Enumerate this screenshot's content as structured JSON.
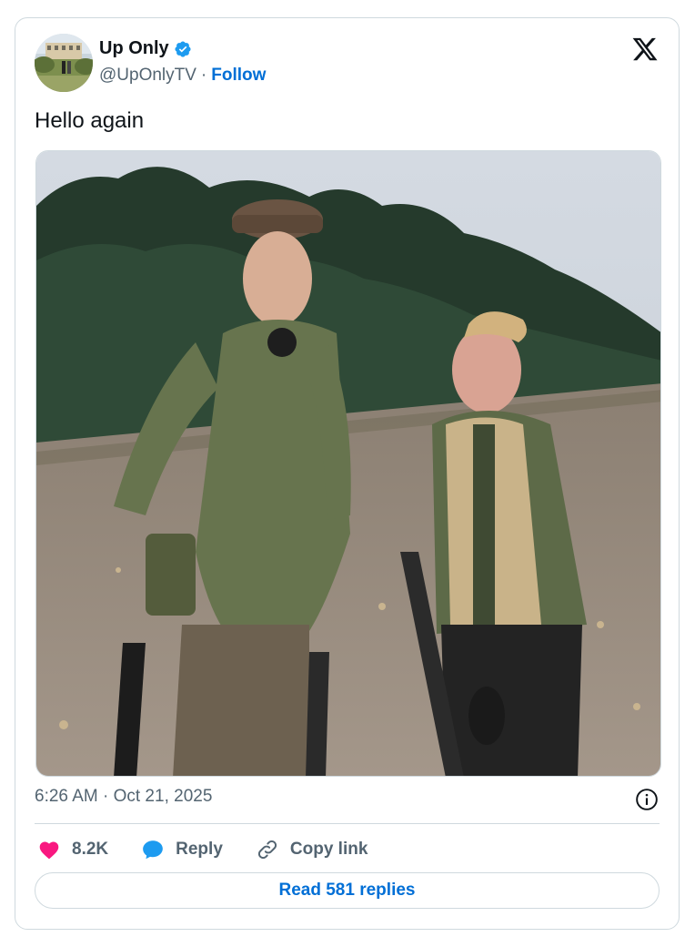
{
  "author": {
    "display_name": "Up Only",
    "handle": "@UpOnlyTV",
    "separator": "·",
    "follow_label": "Follow",
    "verified": true
  },
  "tweet": {
    "text": "Hello again",
    "timestamp": "6:26 AM · Oct 21, 2025"
  },
  "actions": {
    "likes_count": "8.2K",
    "reply_label": "Reply",
    "copy_link_label": "Copy link"
  },
  "read_replies_label": "Read 581 replies",
  "colors": {
    "like_pink": "#f91880",
    "link_blue": "#006fd6",
    "verified_blue": "#1d9bf0",
    "text_primary": "#0f1419",
    "text_secondary": "#536471",
    "border": "#cfd9de"
  },
  "icons": [
    "verified-badge-icon",
    "x-logo-icon",
    "info-icon",
    "heart-icon",
    "reply-bubble-icon",
    "link-icon"
  ]
}
